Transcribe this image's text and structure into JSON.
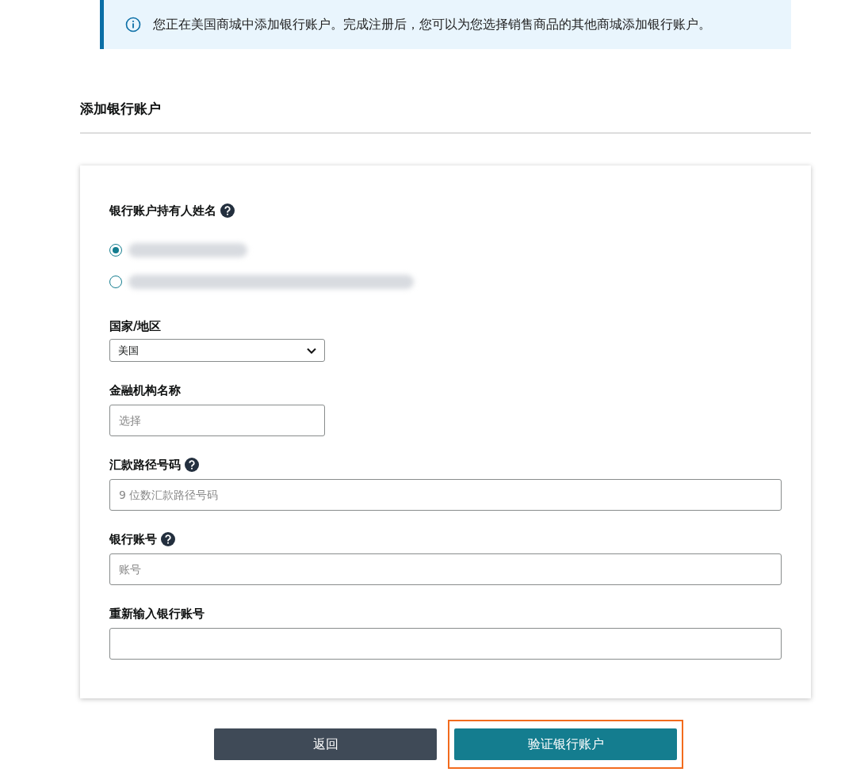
{
  "notice": {
    "text": "您正在美国商城中添加银行账户。完成注册后，您可以为您选择销售商品的其他商城添加银行账户。"
  },
  "heading": "添加银行账户",
  "form": {
    "holder": {
      "label": "银行账户持有人姓名",
      "help": true,
      "options": [
        {
          "selected": true
        },
        {
          "selected": false
        }
      ]
    },
    "country": {
      "label": "国家/地区",
      "value": "美国"
    },
    "institution": {
      "label": "金融机构名称",
      "placeholder": "选择"
    },
    "routing": {
      "label": "汇款路径号码",
      "help": true,
      "placeholder": "9 位数汇款路径号码"
    },
    "account": {
      "label": "银行账号",
      "help": true,
      "placeholder": "账号"
    },
    "reenter": {
      "label": "重新输入银行账号",
      "help": false
    }
  },
  "buttons": [
    {
      "label": "返回",
      "kind": "secondary",
      "highlighted": false
    },
    {
      "label": "验证银行账户",
      "kind": "primary",
      "highlighted": true
    }
  ]
}
